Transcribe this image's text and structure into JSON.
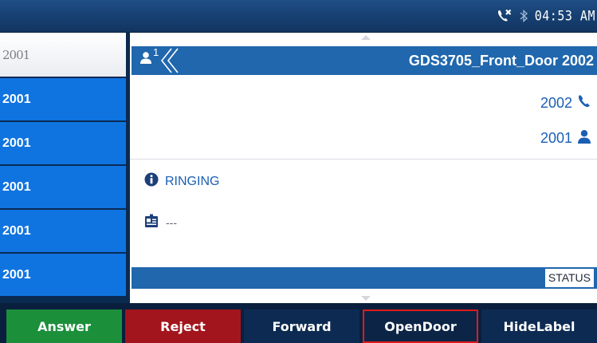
{
  "status_bar": {
    "time": "04:53 AM",
    "icons": [
      "missed-call-icon",
      "bluetooth-icon"
    ]
  },
  "lines": [
    {
      "label": "2001",
      "selected": true
    },
    {
      "label": "2001"
    },
    {
      "label": "2001"
    },
    {
      "label": "2001"
    },
    {
      "label": "2001"
    },
    {
      "label": "2001"
    }
  ],
  "call": {
    "line_badge": "1",
    "title": "GDS3705_Front_Door 2002",
    "remote_number": "2002",
    "local_number": "2001",
    "state": "RINGING",
    "info": "---",
    "status_label": "STATUS"
  },
  "softkeys": [
    {
      "label": "Answer",
      "color": "#1c8f3b"
    },
    {
      "label": "Reject",
      "color": "#a3151c"
    },
    {
      "label": "Forward"
    },
    {
      "label": "OpenDoor",
      "focused": true
    },
    {
      "label": "HideLabel"
    }
  ],
  "colors": {
    "accent": "#2067ad",
    "list_blue": "#0f74e0",
    "text_blue": "#1a5fb4"
  }
}
